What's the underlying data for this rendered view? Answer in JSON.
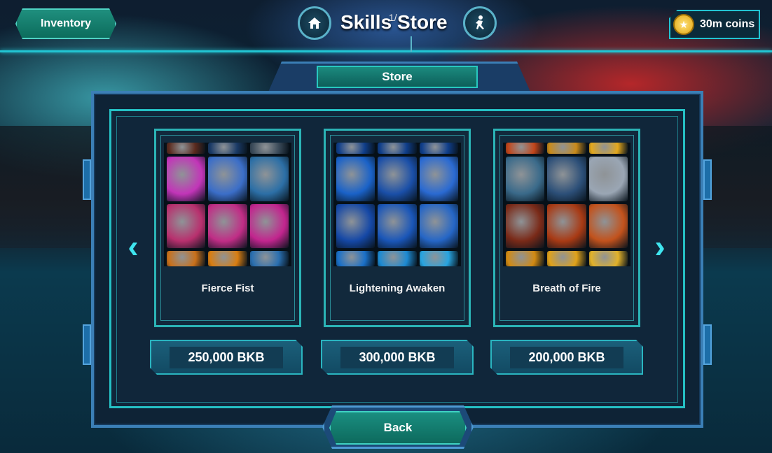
{
  "header": {
    "inventory_label": "Inventory",
    "title": "Skills Store",
    "page_indicator": "1/",
    "home_icon": "home-icon",
    "character_icon": "running-figure-icon",
    "coins_label": "30m coins",
    "coin_icon": "coin-star-icon"
  },
  "store": {
    "tab_label": "Store",
    "back_label": "Back",
    "prev_arrow": "‹",
    "next_arrow": "›"
  },
  "skills": [
    {
      "name": "Fierce Fist",
      "price": "250,000 BKB",
      "tile_colors": [
        "#5a2a1e",
        "#1a3a66",
        "#3b4b5a",
        "#c235b8",
        "#3b6ec8",
        "#2c6fa6",
        "#b8306e",
        "#c02d86",
        "#c2258e",
        "#c9701a",
        "#d97e12",
        "#2a6fb0"
      ]
    },
    {
      "name": "Lightening Awaken",
      "price": "300,000 BKB",
      "tile_colors": [
        "#0f3e8a",
        "#0f3e8a",
        "#0f3e8a",
        "#1a62c8",
        "#1a4fa8",
        "#2a6ad2",
        "#1548a6",
        "#1a56b8",
        "#2566c6",
        "#1a70c8",
        "#1d8ad2",
        "#28a4e0"
      ]
    },
    {
      "name": "Breath of Fire",
      "price": "200,000 BKB",
      "tile_colors": [
        "#c2451a",
        "#c98a1a",
        "#e3a81d",
        "#3a6a8a",
        "#2c4f78",
        "#9aa6b4",
        "#7a2a18",
        "#a83a14",
        "#c2521c",
        "#d28a12",
        "#e0a21a",
        "#e2b22a"
      ]
    }
  ]
}
